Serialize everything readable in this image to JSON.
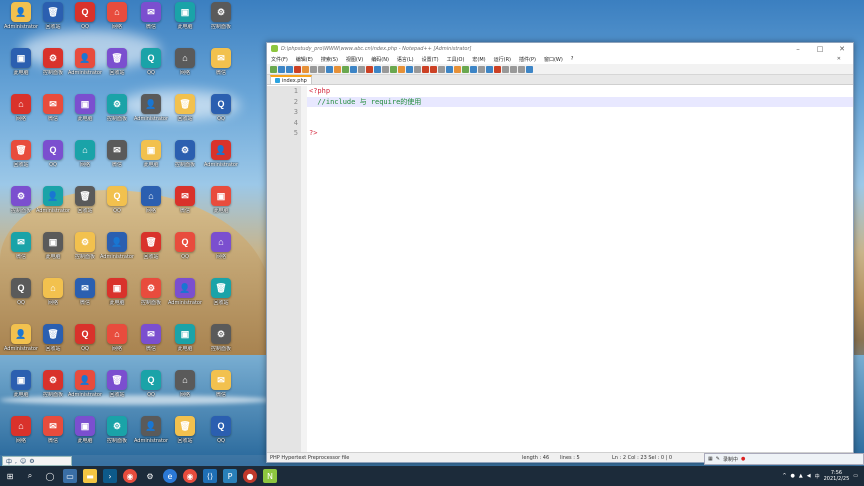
{
  "wallpaper": {
    "accent": "#3b7fc0"
  },
  "desktop_icons": [
    {
      "label": "Administrator",
      "color": "#f2c14e",
      "glyph": "👤"
    },
    {
      "label": "此电脑",
      "color": "#4a90d9",
      "glyph": "▣"
    },
    {
      "label": "网络",
      "color": "#3a7bd5",
      "glyph": "⌂"
    },
    {
      "label": "回收站",
      "color": "#7c8a99",
      "glyph": "🗑"
    },
    {
      "label": "控制面板",
      "color": "#2f79c9",
      "glyph": "⚙"
    },
    {
      "label": "微信",
      "color": "#4cbf46",
      "glyph": "✉"
    },
    {
      "label": "QQ",
      "color": "#222",
      "glyph": "Q"
    }
  ],
  "window": {
    "title": "D:\\phpstudy_pro\\WWW\\www.abc.cn\\index.php - Notepad++ [Administrator]",
    "menu": [
      "文件(F)",
      "编辑(E)",
      "搜索(S)",
      "视图(V)",
      "编码(N)",
      "语言(L)",
      "设置(T)",
      "工具(O)",
      "宏(M)",
      "运行(R)",
      "插件(P)",
      "窗口(W)",
      "?"
    ],
    "close_glyph": "✕",
    "tab_label": "index.php",
    "lines": [
      {
        "no": "1",
        "text": "<?php",
        "cls": "php-tag"
      },
      {
        "no": "2",
        "text": "  //include 与 require的使用",
        "cls": "comment"
      },
      {
        "no": "3",
        "text": "",
        "cls": ""
      },
      {
        "no": "4",
        "text": "",
        "cls": ""
      },
      {
        "no": "5",
        "text": "?>",
        "cls": "php-tag"
      }
    ],
    "status": {
      "type": "PHP Hypertext Preprocessor file",
      "length": "length : 46",
      "lines": "lines : 5",
      "pos": "Ln : 2   Col : 23   Sel : 0 | 0"
    }
  },
  "taskbar": {
    "time": "7:56",
    "date": "2021/2/25",
    "ime": "中"
  },
  "rec_bar": {
    "label": "录制中"
  }
}
